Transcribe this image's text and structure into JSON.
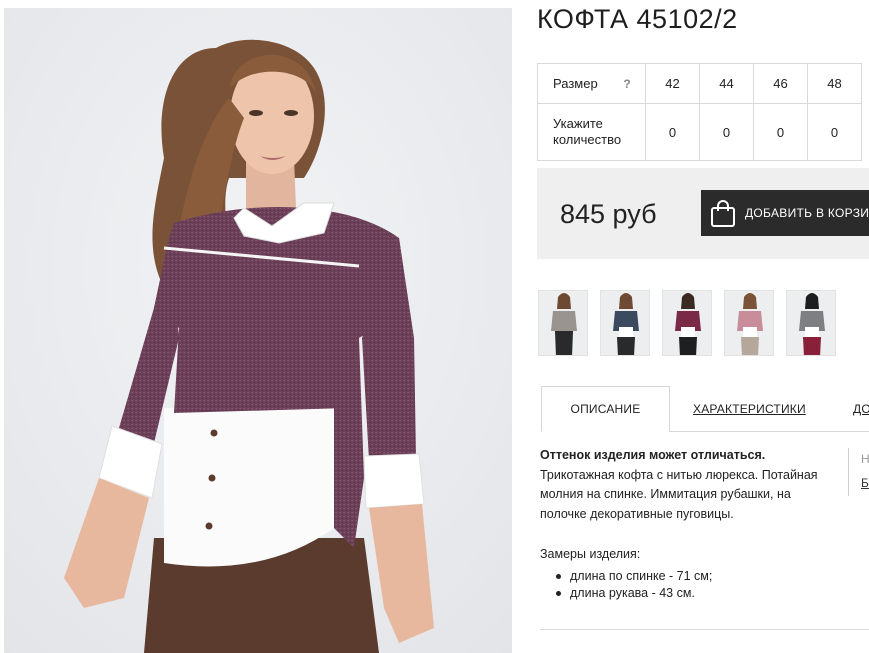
{
  "product": {
    "title": "КОФТА 45102/2",
    "image_alt_icon": "product-photo"
  },
  "size_table": {
    "size_label": "Размер",
    "help_icon": "?",
    "sizes": [
      "42",
      "44",
      "46",
      "48"
    ],
    "qty_label": "Укажите количество",
    "quantities": [
      "0",
      "0",
      "0",
      "0"
    ]
  },
  "price": {
    "amount": "845 руб",
    "cart_button": "ДОБАВИТЬ В КОРЗИНУ",
    "cart_icon": "shopping-bag-icon"
  },
  "thumbnails": [
    {
      "name": "grey",
      "top_color": "#9a9490",
      "bottom_color": "#2a2a2c"
    },
    {
      "name": "navy",
      "top_color": "#3b4a5e",
      "bottom_color": "#2a2a2c"
    },
    {
      "name": "bordeaux",
      "top_color": "#7a2a45",
      "bottom_color": "#1f1f22"
    },
    {
      "name": "pink",
      "top_color": "#c88c9a",
      "bottom_color": "#b5a89b"
    },
    {
      "name": "grey-black",
      "top_color": "#7d7f83",
      "bottom_color": "#8a1f3a"
    }
  ],
  "tabs": [
    "ОПИСАНИЕ",
    "ХАРАКТЕРИСТИКИ",
    "ДОСТАВКА"
  ],
  "description": {
    "bold": "Оттенок изделия может отличаться.",
    "text": "Трикотажная кофта с нитью люрекса. Потайная молния на спинке. Иммитация рубашки, на полочке декоративные пуговицы.",
    "measures_title": "Замеры изделия:",
    "measures": [
      "длина по спинке - 71 см;",
      "длина рукава - 43 см."
    ]
  },
  "sidebar": {
    "h": "Н",
    "b": "Б"
  },
  "colors": {
    "button_bg": "#2b2b2b",
    "price_bg": "#efefef",
    "sweater": "#6b3f57",
    "shirt": "#ffffff"
  }
}
